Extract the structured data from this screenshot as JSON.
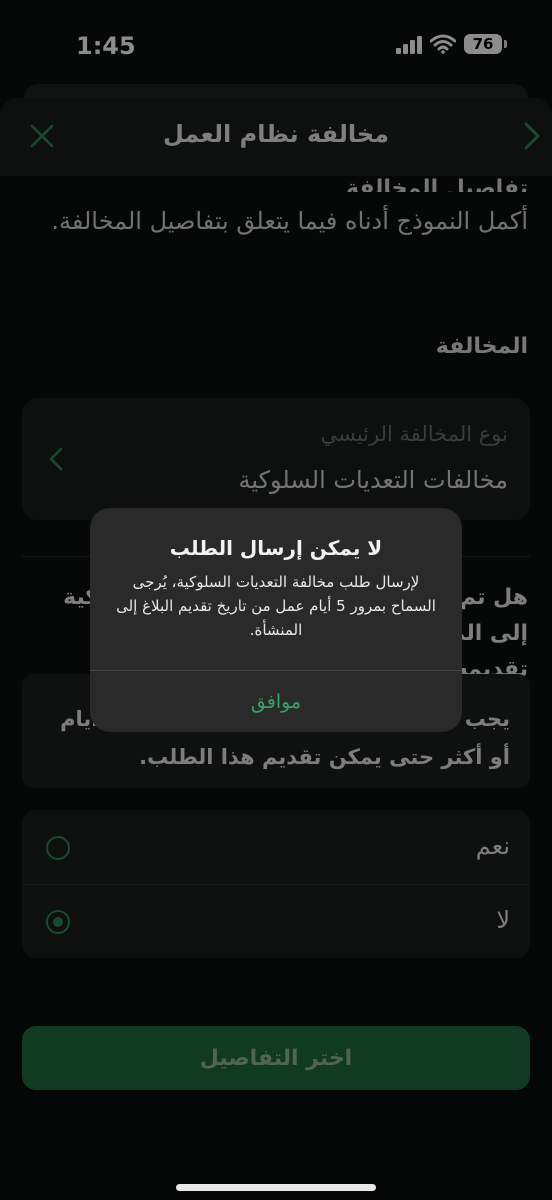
{
  "status_bar": {
    "time": "1:45",
    "battery": "76"
  },
  "header": {
    "title": "مخالفة نظام العمل"
  },
  "form": {
    "cut_heading": "تفاصيل المخالفة",
    "description": "أكمل النموذج أدناه فيما يتعلق بتفاصيل المخالفة.",
    "section_title": "المخالفة",
    "violation_type": {
      "label": "نوع المخالفة الرئيسي",
      "value": "مخالفات التعديات السلوكية"
    },
    "question": "هل تم الإبلاغ عن مخالفة التعديات السلوكية إلى المنشأة ومرور 5 أيام عمل من تاريخ تقديمه؟",
    "note": "يجب أن يكون قد مر على تقديم البلاغ 5 أيام أو أكثر حتى يمكن تقديم هذا الطلب.",
    "options": [
      {
        "label": "نعم",
        "selected": false
      },
      {
        "label": "لا",
        "selected": true
      }
    ],
    "submit_label": "اختر التفاصيل"
  },
  "alert": {
    "title": "لا يمكن إرسال الطلب",
    "message": "لإرسال طلب مخالفة التعديات السلوكية، يُرجى السماح بمرور 5 أيام عمل من تاريخ تقديم البلاغ إلى المنشأة.",
    "ok_label": "موافق"
  },
  "colors": {
    "accent": "#2e8a55",
    "alert_button": "#33a466",
    "background": "#0b0f0e"
  }
}
